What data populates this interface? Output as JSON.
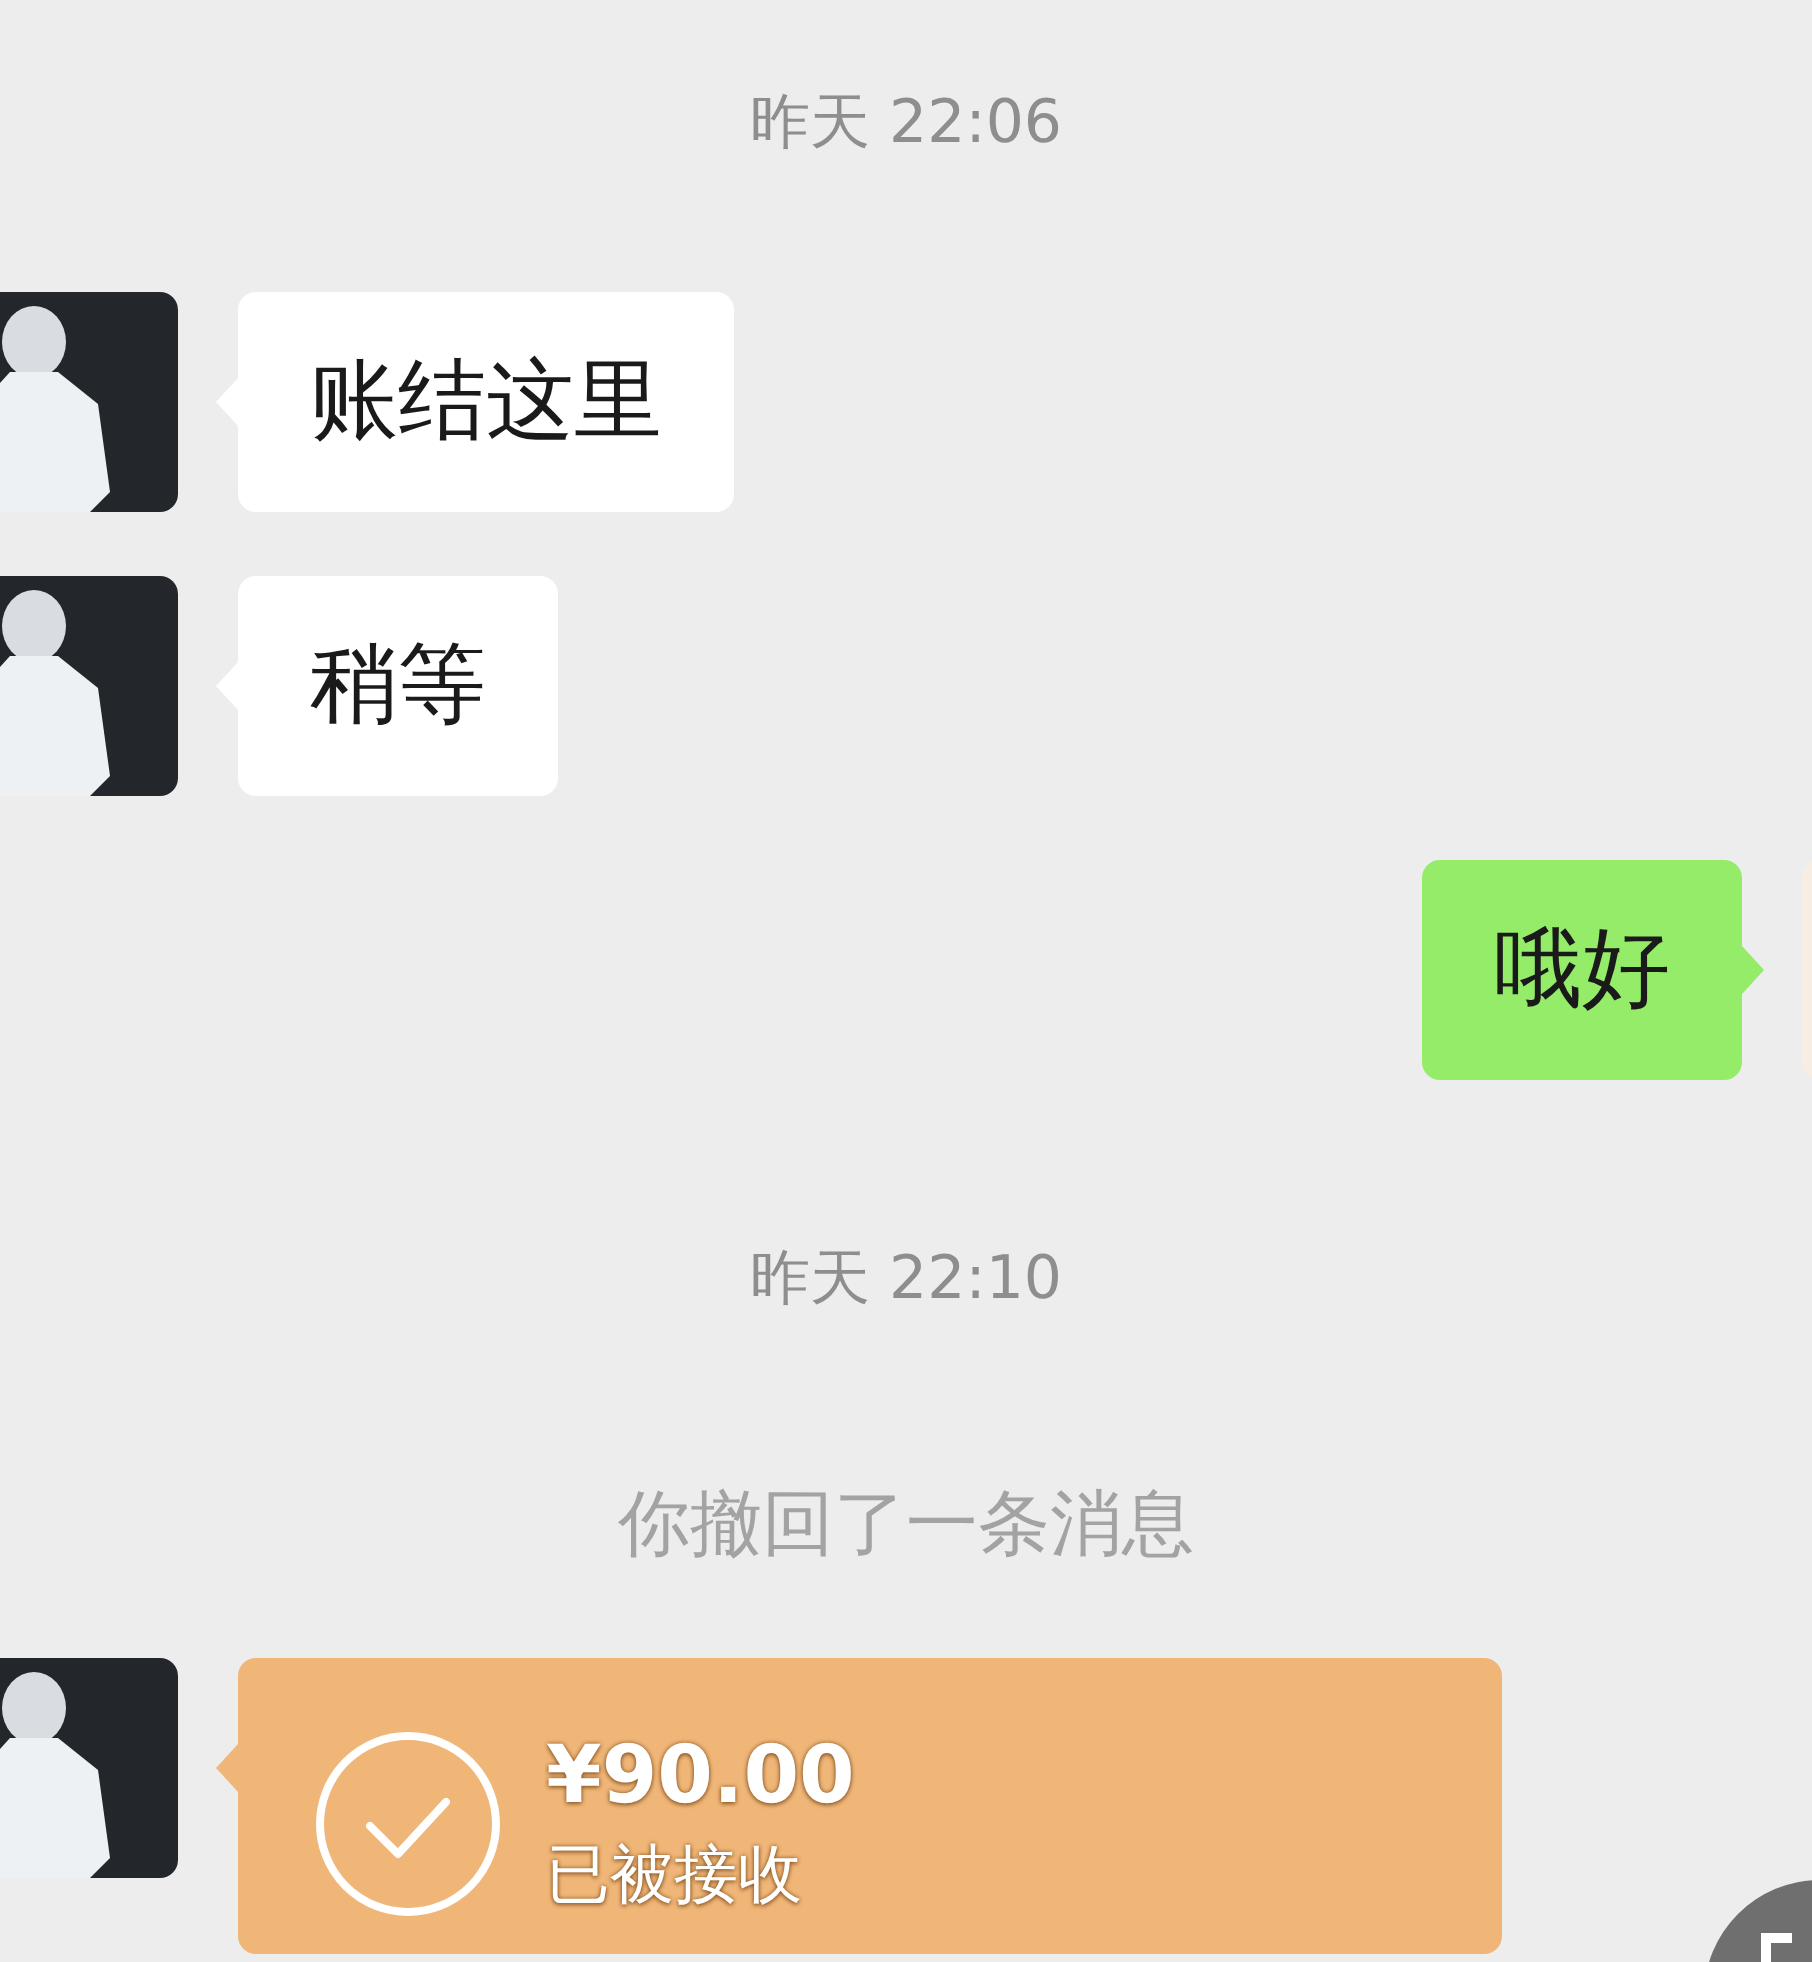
{
  "messages": [
    {
      "kind": "time",
      "text": "昨天 22:06"
    },
    {
      "kind": "received",
      "text": "账结这里"
    },
    {
      "kind": "received",
      "text": "稍等"
    },
    {
      "kind": "sent",
      "text": "哦好"
    },
    {
      "kind": "time",
      "text": "昨天 22:10"
    },
    {
      "kind": "recall",
      "text": "你撤回了一条消息"
    },
    {
      "kind": "transfer",
      "amount": "¥90.00",
      "status": "已被接收"
    }
  ]
}
